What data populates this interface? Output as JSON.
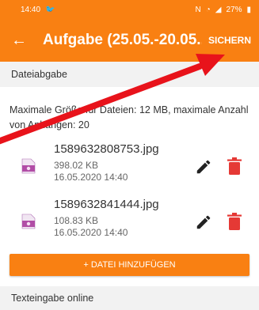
{
  "status_bar": {
    "time": "14:40",
    "battery": "27%"
  },
  "app_bar": {
    "title": "Aufgabe (25.05.-20.05....",
    "save_label": "SICHERN"
  },
  "section_file": {
    "title": "Dateiabgabe"
  },
  "info": {
    "text": "Maximale Größe für Dateien: 12 MB, maximale Anzahl von Anhängen: 20"
  },
  "files": [
    {
      "name": "1589632808753.jpg",
      "size": "398.02 KB",
      "date": "16.05.2020 14:40"
    },
    {
      "name": "1589632841444.jpg",
      "size": "108.83 KB",
      "date": "16.05.2020 14:40"
    }
  ],
  "add_button": {
    "label": "+ DATEI HINZUFÜGEN"
  },
  "section_text": {
    "title": "Texteingabe online"
  },
  "colors": {
    "accent": "#f98012",
    "delete": "#e53935",
    "annotation_arrow": "#e8131b"
  }
}
